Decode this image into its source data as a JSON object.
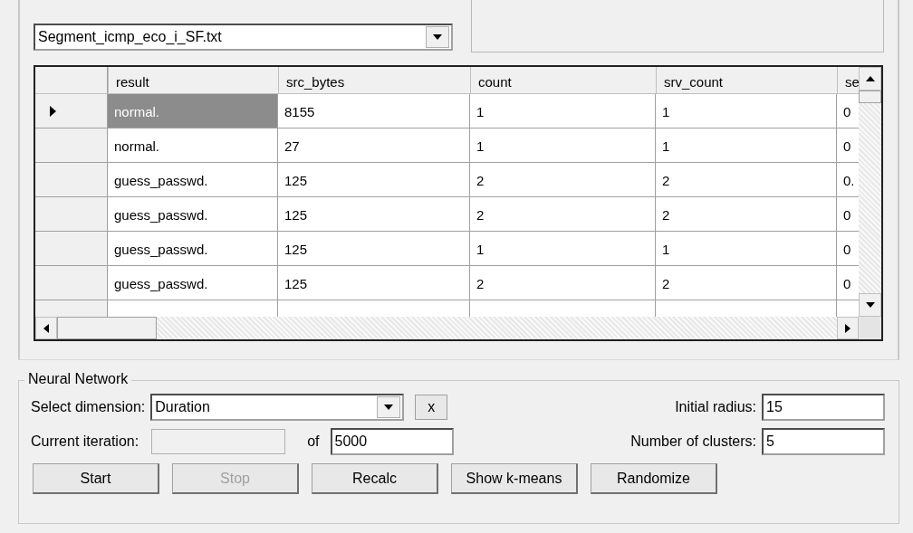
{
  "file_select": {
    "value": "Segment_icmp_eco_i_SF.txt"
  },
  "table": {
    "columns": [
      "result",
      "src_bytes",
      "count",
      "srv_count",
      "se"
    ],
    "rows": [
      {
        "selected": true,
        "cells": [
          "normal.",
          "8155",
          "1",
          "1",
          "0"
        ]
      },
      {
        "selected": false,
        "cells": [
          "normal.",
          "27",
          "1",
          "1",
          "0"
        ]
      },
      {
        "selected": false,
        "cells": [
          "guess_passwd.",
          "125",
          "2",
          "2",
          "0."
        ]
      },
      {
        "selected": false,
        "cells": [
          "guess_passwd.",
          "125",
          "2",
          "2",
          "0"
        ]
      },
      {
        "selected": false,
        "cells": [
          "guess_passwd.",
          "125",
          "1",
          "1",
          "0"
        ]
      },
      {
        "selected": false,
        "cells": [
          "guess_passwd.",
          "125",
          "2",
          "2",
          "0"
        ]
      }
    ]
  },
  "neural_network": {
    "title": "Neural Network",
    "dimension_label": "Select dimension:",
    "dimension_value": "Duration",
    "clear_button": "x",
    "radius_label": "Initial radius:",
    "radius_value": "15",
    "iteration_label": "Current iteration:",
    "iteration_disabled": true,
    "of_label": "of",
    "iterations_value": "5000",
    "clusters_label": "Number of clusters:",
    "clusters_value": "5",
    "buttons": [
      {
        "label": "Start",
        "disabled": false
      },
      {
        "label": "Stop",
        "disabled": true
      },
      {
        "label": "Recalc",
        "disabled": false
      },
      {
        "label": "Show k-means",
        "disabled": false
      },
      {
        "label": "Randomize",
        "disabled": false
      }
    ]
  }
}
